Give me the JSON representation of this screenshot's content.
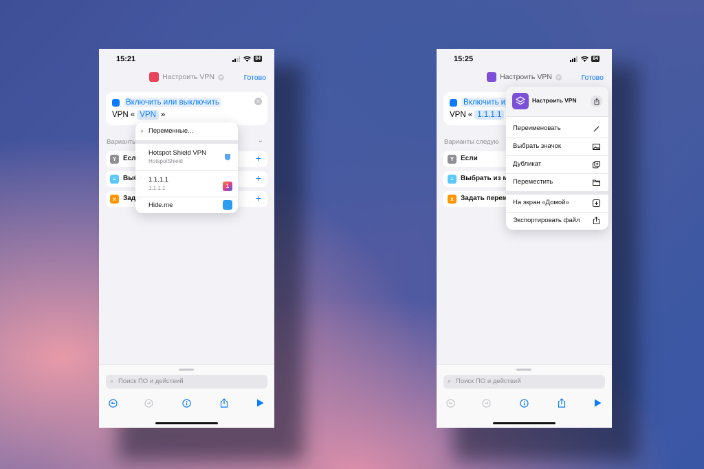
{
  "left_phone": {
    "status": {
      "time": "15:21",
      "battery": "84"
    },
    "nav": {
      "title": "Настроить VPN",
      "done": "Готово"
    },
    "action": {
      "title": "Включить или выключить",
      "prefix": "VPN «",
      "token": "VPN",
      "suffix": "»"
    },
    "suggestions_header": "Варианты",
    "suggestions": [
      {
        "label": "Если",
        "icon": "y-icon",
        "color": "#8e8e93"
      },
      {
        "label": "Выбр",
        "icon": "menu-icon",
        "color": "#5ac8fa"
      },
      {
        "label": "Задат",
        "icon": "x-var-icon",
        "color": "#ff9500"
      }
    ],
    "popup": {
      "variables": "Переменные...",
      "items": [
        {
          "title": "Hotspot Shield VPN",
          "subtitle": "HotspotShield",
          "icon": "shield-icon"
        },
        {
          "title": "1.1.1.1",
          "subtitle": "1.1.1.1",
          "icon": "cloudflare-1111-icon"
        },
        {
          "title": "Hide.me",
          "subtitle": "",
          "icon": "hideme-icon"
        }
      ]
    },
    "search_placeholder": "Поиск ПО и действий"
  },
  "right_phone": {
    "status": {
      "time": "15:25",
      "battery": "84"
    },
    "nav": {
      "title": "Настроить VPN",
      "done": "Готово"
    },
    "action": {
      "title": "Включить или выключить",
      "prefix": "VPN «",
      "token": "1.1.1.1",
      "suffix": "»"
    },
    "suggestions_header": "Варианты следую",
    "suggestions": [
      {
        "label": "Если",
        "icon": "y-icon",
        "color": "#8e8e93"
      },
      {
        "label": "Выбрать из м",
        "icon": "menu-icon",
        "color": "#5ac8fa"
      },
      {
        "label": "Задать перем",
        "icon": "x-var-icon",
        "color": "#ff9500"
      }
    ],
    "context_menu": {
      "header_title": "Настроить VPN",
      "items": [
        {
          "label": "Переименовать",
          "icon": "pencil-icon"
        },
        {
          "label": "Выбрать значок",
          "icon": "photo-icon"
        },
        {
          "label": "Дубликат",
          "icon": "duplicate-icon"
        },
        {
          "label": "Переместить",
          "icon": "folder-icon"
        }
      ],
      "items2": [
        {
          "label": "На экран «Домой»",
          "icon": "add-square-icon"
        },
        {
          "label": "Экспортировать файл",
          "icon": "share-icon"
        }
      ]
    },
    "search_placeholder": "Поиск ПО и действий"
  },
  "colors": {
    "accent": "#0a7aff",
    "shortcut_purple": "#7b4fd6",
    "shortcut_red": "#e8435a"
  }
}
